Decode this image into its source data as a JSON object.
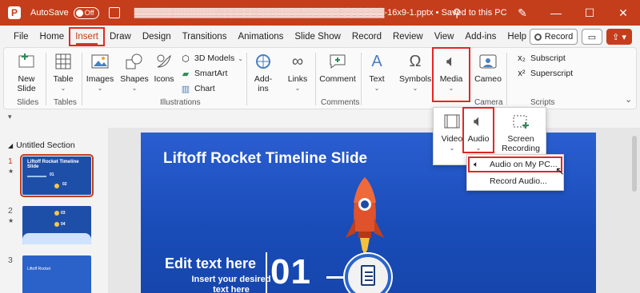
{
  "titlebar": {
    "logo_letter": "P",
    "autosave_label": "AutoSave",
    "autosave_state": "Off",
    "filename": "▓▓▓▓▓▓▓▓▓▓▓▓▓▓▓▓▓▓▓▓▓▓▓▓▓▓▓▓▓▓▓▓▓▓▓▓▓▓▓-16x9-1.pptx",
    "save_status": "Saved to this PC",
    "search_icon": "search-icon"
  },
  "tabs": [
    {
      "label": "File"
    },
    {
      "label": "Home"
    },
    {
      "label": "Insert"
    },
    {
      "label": "Draw"
    },
    {
      "label": "Design"
    },
    {
      "label": "Transitions"
    },
    {
      "label": "Animations"
    },
    {
      "label": "Slide Show"
    },
    {
      "label": "Record"
    },
    {
      "label": "Review"
    },
    {
      "label": "View"
    },
    {
      "label": "Add-ins"
    },
    {
      "label": "Help"
    }
  ],
  "record_btn": "Record",
  "ribbon": {
    "new_slide": "New\nSlide",
    "table": "Table",
    "images": "Images",
    "shapes": "Shapes",
    "icons": "Icons",
    "models": "3D Models",
    "smartart": "SmartArt",
    "chart": "Chart",
    "addins": "Add-\nins",
    "links": "Links",
    "comment": "Comment",
    "text": "Text",
    "symbols": "Symbols",
    "media": "Media",
    "cameo": "Cameo",
    "subscript": "Subscript",
    "superscript": "Superscript",
    "groups": {
      "slides": "Slides",
      "tables": "Tables",
      "illustrations": "Illustrations",
      "comments": "Comments",
      "camera": "Camera",
      "scripts": "Scripts"
    }
  },
  "media_menu": {
    "video": "Video",
    "audio": "Audio",
    "screen_recording": "Screen\nRecording"
  },
  "audio_menu": {
    "audio_on_pc": "Audio on My PC...",
    "record_audio": "Record Audio..."
  },
  "panel": {
    "section": "Untitled Section",
    "slides": [
      {
        "num": "1",
        "title": "Liftoff Rocket Timeline Slide",
        "labels": [
          "01",
          "02"
        ]
      },
      {
        "num": "2",
        "labels": [
          "03",
          "04"
        ]
      },
      {
        "num": "3",
        "title": "Liftoff Rocket"
      }
    ]
  },
  "slide": {
    "title": "Liftoff Rocket Timeline Slide",
    "edit_title": "Edit text here",
    "edit_sub": "Insert your desired\ntext here",
    "number": "01"
  }
}
